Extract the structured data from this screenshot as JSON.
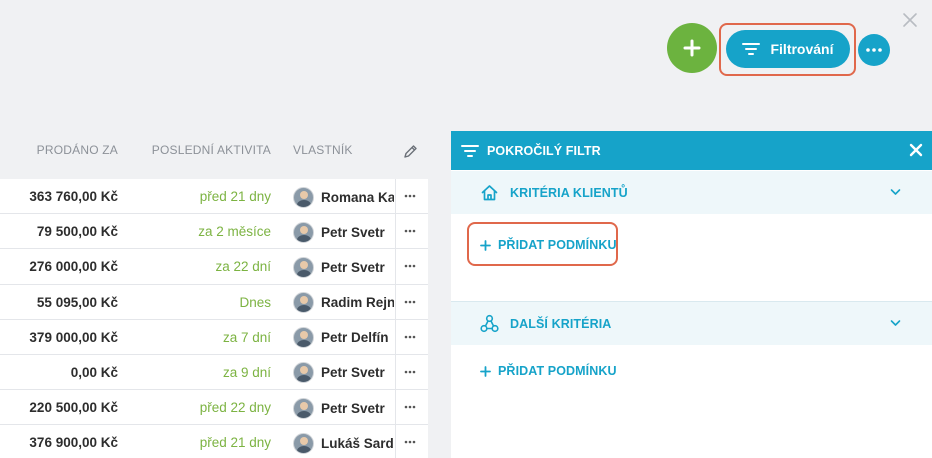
{
  "toolbar": {
    "filter_label": "Filtrování",
    "add_icon": "plus-icon",
    "more_icon": "more-dots-icon",
    "close_icon": "close-icon",
    "colors": {
      "green": "#6cb33f",
      "blue": "#16a3c9",
      "highlight": "#e0684b"
    }
  },
  "table": {
    "columns": {
      "sold": "PRODÁNO ZA",
      "activity": "POSLEDNÍ AKTIVITA",
      "owner": "VLASTNÍK"
    },
    "rows": [
      {
        "sold": "363 760,00 Kč",
        "activity": "před 21 dny",
        "owner": "Romana Ka"
      },
      {
        "sold": "79 500,00 Kč",
        "activity": "za 2 měsíce",
        "owner": "Petr Svetr"
      },
      {
        "sold": "276 000,00 Kč",
        "activity": "za 22 dní",
        "owner": "Petr Svetr"
      },
      {
        "sold": "55 095,00 Kč",
        "activity": "Dnes",
        "owner": "Radim Rejn"
      },
      {
        "sold": "379 000,00 Kč",
        "activity": "za 7 dní",
        "owner": "Petr Delfín"
      },
      {
        "sold": "0,00 Kč",
        "activity": "za 9 dní",
        "owner": "Petr Svetr"
      },
      {
        "sold": "220 500,00 Kč",
        "activity": "před 22 dny",
        "owner": "Petr Svetr"
      },
      {
        "sold": "376 900,00 Kč",
        "activity": "před 21 dny",
        "owner": "Lukáš Sardi"
      }
    ]
  },
  "panel": {
    "title": "POKROČILÝ FILTR",
    "sections": [
      {
        "title": "KRITÉRIA KLIENTŮ",
        "icon": "home-icon",
        "add_label": "PŘIDAT PODMÍNKU"
      },
      {
        "title": "DALŠÍ KRITÉRIA",
        "icon": "nodes-icon",
        "add_label": "PŘIDAT PODMÍNKU"
      }
    ]
  }
}
